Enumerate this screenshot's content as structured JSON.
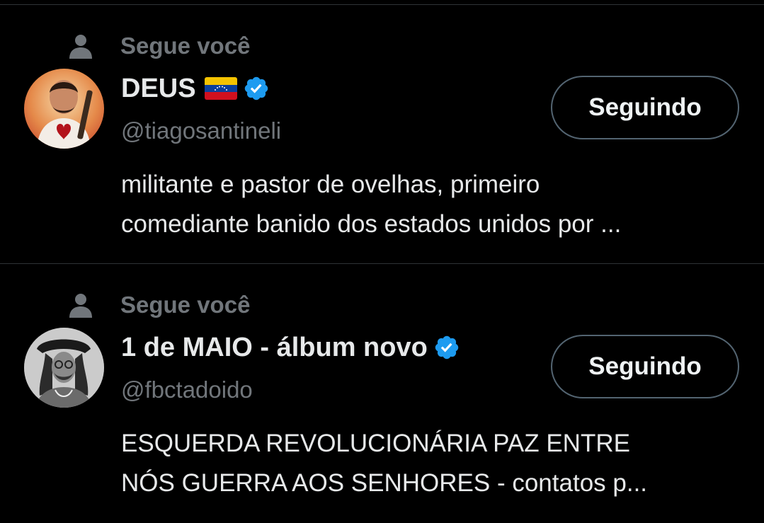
{
  "users": [
    {
      "follows_you": "Segue você",
      "name": "DEUS",
      "flag_icon": "venezuela-flag-icon",
      "verified_icon": "verified-badge-icon",
      "handle": "@tiagosantineli",
      "button_label": "Seguindo",
      "bio_line1": "militante e pastor de ovelhas, primeiro",
      "bio_line2": "comediante banido dos estados unidos por ..."
    },
    {
      "follows_you": "Segue você",
      "name": "1 de MAIO - álbum novo",
      "verified_icon": "verified-badge-icon",
      "handle": "@fbctadoido",
      "button_label": "Seguindo",
      "bio_line1": "ESQUERDA REVOLUCIONÁRIA PAZ ENTRE",
      "bio_line2": "NÓS GUERRA AOS SENHORES - contatos p..."
    }
  ],
  "colors": {
    "background": "#000000",
    "primary_text": "#e7e9ea",
    "secondary_text": "#71767b",
    "verified_blue": "#1d9bf0",
    "divider": "#2f3336",
    "button_border": "#536471"
  }
}
